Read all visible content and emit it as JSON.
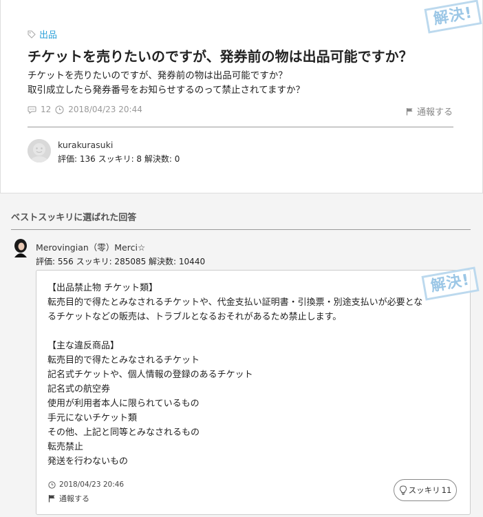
{
  "question": {
    "category": "出品",
    "title": "チケットを売りたいのですが、発券前の物は出品可能ですか？",
    "body": [
      "チケットを売りたいのですが、発券前の物は出品可能ですか？",
      "取引成立したら発券番号をお知らせするのって禁止されてますか？"
    ],
    "comment_count": "12",
    "date": "2018/04/23 20:44",
    "report_label": "通報する",
    "stamp": "解決!",
    "user": {
      "name": "kurakurasuki",
      "stats": "評価: 136   スッキリ: 8   解決数: 0"
    }
  },
  "answer_section": {
    "title": "ベストスッキリに選ばれた回答",
    "user": {
      "name": "Merovingian（零）Merci☆",
      "stats": "評価: 556   スッキリ: 285085   解決数: 10440"
    },
    "body": [
      "【出品禁止物 チケット類】",
      "転売目的で得たとみなされるチケットや、代金支払い証明書・引換票・別途支払いが必要とな",
      "るチケットなどの販売は、トラブルとなるおそれがあるため禁止します。",
      "",
      "【主な違反商品】",
      "転売目的で得たとみなされるチケット",
      "記名式チケットや、個人情報の登録のあるチケット",
      "記名式の航空券",
      "使用が利用者本人に限られているもの",
      "手元にないチケット類",
      "その他、上記と同等とみなされるもの",
      "転売禁止",
      "発送を行わないもの"
    ],
    "date": "2018/04/23 20:46",
    "report_label": "通報する",
    "stamp": "解決!",
    "sukkiri_label": "スッキリ",
    "sukkiri_count": "11"
  },
  "colors": {
    "accent": "#2a9fd8",
    "stamp": "#9cc7e6",
    "band": "#f4f4f4"
  },
  "icons": [
    "tag-icon",
    "comment-icon",
    "clock-icon",
    "flag-icon",
    "lightbulb-icon"
  ]
}
